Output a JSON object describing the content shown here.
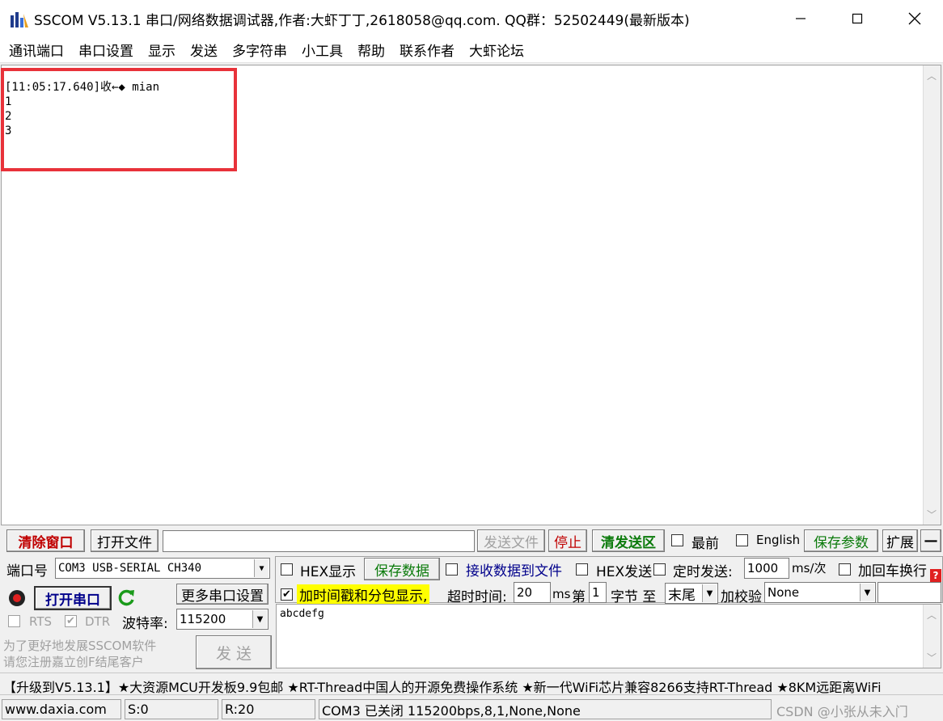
{
  "window": {
    "title": "SSCOM V5.13.1 串口/网络数据调试器,作者:大虾丁丁,2618058@qq.com. QQ群：52502449(最新版本)"
  },
  "menu": [
    "通讯端口",
    "串口设置",
    "显示",
    "发送",
    "多字符串",
    "小工具",
    "帮助",
    "联系作者",
    "大虾论坛"
  ],
  "receive": {
    "text": "[11:05:17.640]收←◆ mian\n1\n2\n3"
  },
  "toolbar": {
    "clear_window": "清除窗口",
    "open_file": "打开文件",
    "send_file": "发送文件",
    "stop": "停止",
    "clear_send": "清发送区",
    "topmost": "最前",
    "english": "English",
    "save_params": "保存参数",
    "expand": "扩展",
    "collapse": "—"
  },
  "port": {
    "port_label": "端口号",
    "port_value": "COM3 USB-SERIAL CH340",
    "open_button": "打开串口",
    "more_settings": "更多串口设置",
    "rts": "RTS",
    "dtr": "DTR",
    "baud_label": "波特率:",
    "baud_value": "115200",
    "promo": "为了更好地发展SSCOM软件\n请您注册嘉立创F结尾客户",
    "send_button": "发 送"
  },
  "options": {
    "hex_display": "HEX显示",
    "save_data": "保存数据",
    "recv_to_file": "接收数据到文件",
    "hex_send": "HEX发送",
    "timed_send": "定时发送:",
    "interval_value": "1000",
    "interval_unit": "ms/次",
    "add_crlf": "加回车换行",
    "timestamp_split": "加时间戳和分包显示,",
    "timeout_label": "超时时间:",
    "timeout_value": "20",
    "timeout_unit": "ms",
    "byte_prefix": "第",
    "byte_value": "1",
    "byte_suffix": "字节 至",
    "end_value": "末尾",
    "checksum_label": "加校验",
    "checksum_value": "None"
  },
  "send": {
    "text": "abcdefg"
  },
  "marquee": {
    "text": "【升级到V5.13.1】★大资源MCU开发板9.9包邮 ★RT-Thread中国人的开源免费操作系统 ★新一代WiFi芯片兼容8266支持RT-Thread ★8KM远距离WiFi"
  },
  "status": {
    "website": "www.daxia.com",
    "sent": "S:0",
    "received": "R:20",
    "port_status": "COM3 已关闭  115200bps,8,1,None,None",
    "watermark": "CSDN @小张从未入门"
  },
  "colors": {
    "highlight_red": "#e8323a",
    "dark_red_text": "#c00000",
    "green_text": "#0a7a0a",
    "blue_text": "#00008b",
    "timestamp_bg": "#ffff00"
  }
}
